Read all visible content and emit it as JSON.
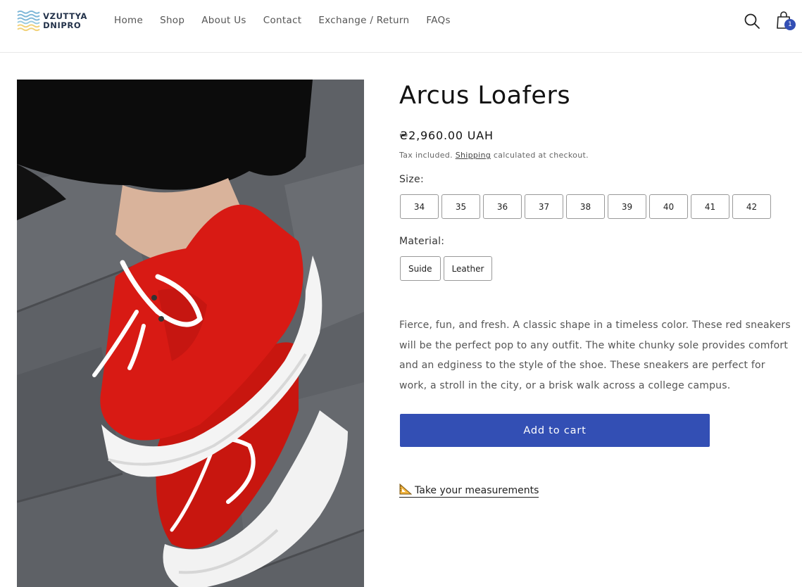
{
  "brand": {
    "logo_line1": "VZUTTYA",
    "logo_line2": "DNIPRO",
    "logo_colors": [
      "#7fb8d8",
      "#f1d27a"
    ]
  },
  "nav": {
    "items": [
      {
        "label": "Home"
      },
      {
        "label": "Shop"
      },
      {
        "label": "About Us"
      },
      {
        "label": "Contact"
      },
      {
        "label": "Exchange / Return"
      },
      {
        "label": "FAQs"
      }
    ]
  },
  "header_icons": {
    "search": "search-icon",
    "cart": "shopping-bag-icon",
    "cart_count": "1"
  },
  "product": {
    "title": "Arcus Loafers",
    "price": "₴2,960.00 UAH",
    "tax_prefix": "Tax included.",
    "tax_link": "Shipping",
    "tax_suffix": "calculated at checkout.",
    "size_label": "Size:",
    "sizes": [
      "34",
      "35",
      "36",
      "37",
      "38",
      "39",
      "40",
      "41",
      "42"
    ],
    "material_label": "Material:",
    "materials": [
      "Suide",
      "Leather"
    ],
    "description": "Fierce, fun, and fresh. A classic shape in a timeless color. These red sneakers will be the perfect pop to any outfit. The white chunky sole provides comfort and an edginess to the style of the shoe. These sneakers are perfect for work, a stroll in the city, or a brisk walk across a college campus.",
    "add_to_cart": "Add to cart",
    "measure_link": "Take your measurements"
  },
  "colors": {
    "accent": "#334fb4",
    "shoe_red": "#d81a14",
    "sole_white": "#f4f4f4",
    "ground": "#5a5d62"
  }
}
